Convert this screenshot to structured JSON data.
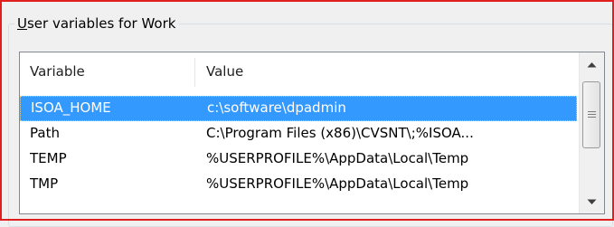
{
  "group": {
    "label": "User variables for Work",
    "access_key": "U",
    "label_rest": "ser variables for Work"
  },
  "table": {
    "columns": [
      "Variable",
      "Value"
    ],
    "rows": [
      {
        "variable": "ISOA_HOME",
        "value": "c:\\software\\dpadmin",
        "selected": true
      },
      {
        "variable": "Path",
        "value": "C:\\Program Files (x86)\\CVSNT\\;%ISOA...",
        "selected": false
      },
      {
        "variable": "TEMP",
        "value": "%USERPROFILE%\\AppData\\Local\\Temp",
        "selected": false
      },
      {
        "variable": "TMP",
        "value": "%USERPROFILE%\\AppData\\Local\\Temp",
        "selected": false
      }
    ]
  },
  "scrollbar": {
    "up_icon": "chevron-up-icon",
    "down_icon": "chevron-down-icon",
    "grip_icon": "grip-lines-icon"
  },
  "colors": {
    "selection": "#3399ff",
    "frame_accent": "#e21f1f"
  }
}
